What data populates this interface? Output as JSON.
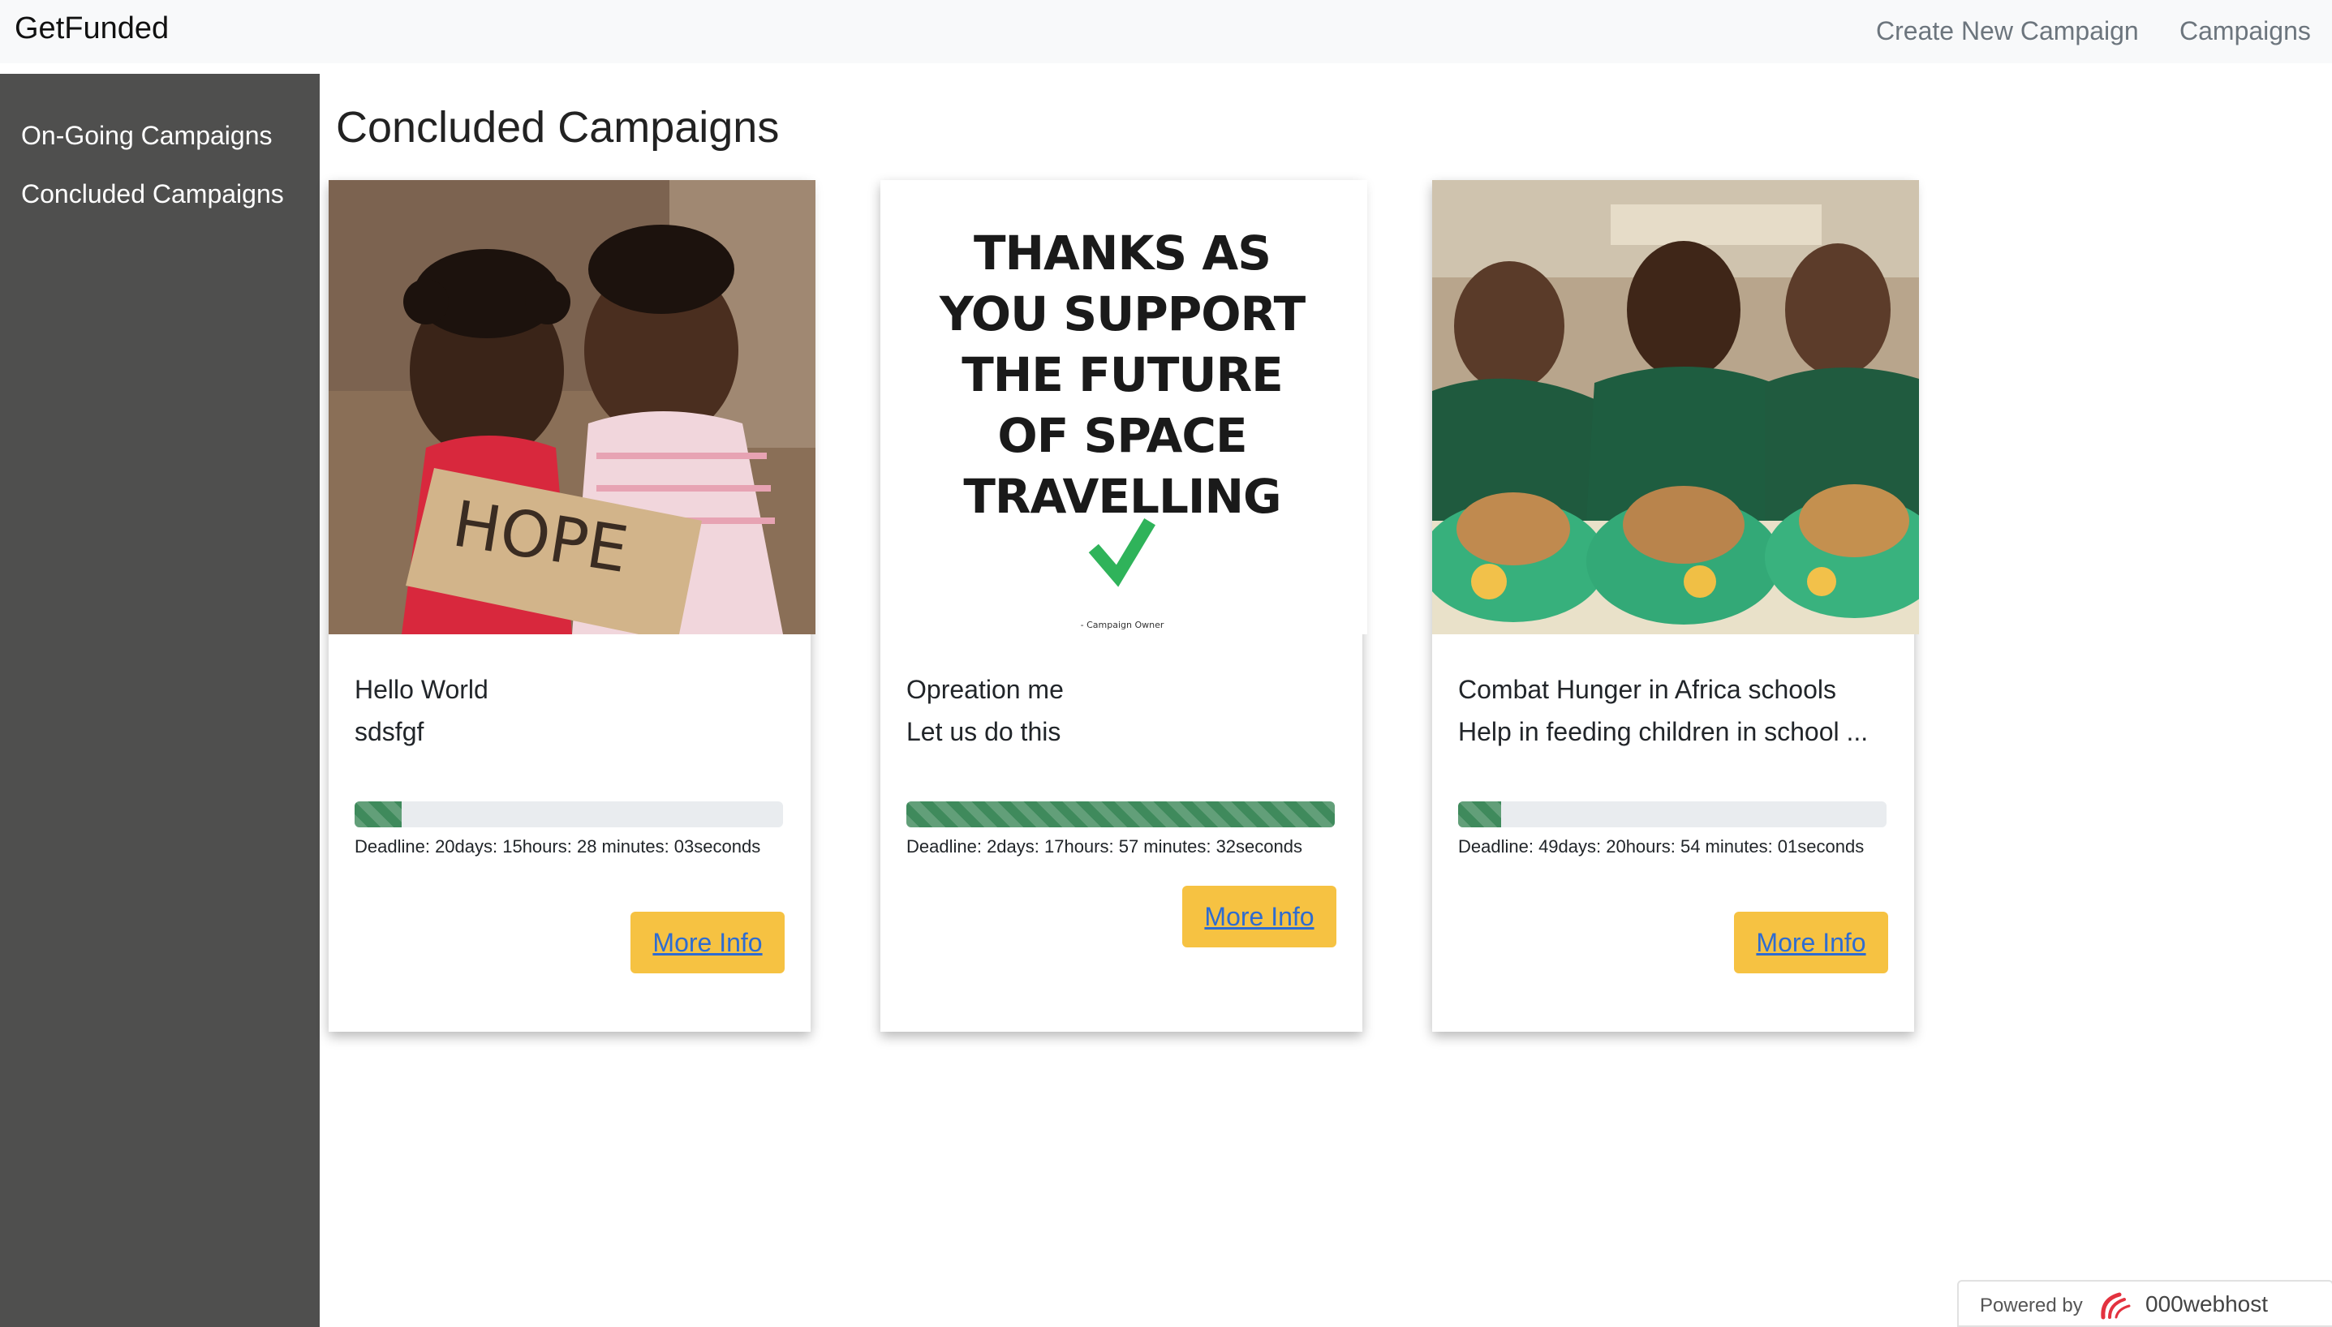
{
  "navbar": {
    "brand": "GetFunded",
    "links": [
      "Create New Campaign",
      "Campaigns"
    ]
  },
  "sidebar": {
    "items": [
      {
        "label": "On-Going Campaigns"
      },
      {
        "label": "Concluded Campaigns"
      }
    ]
  },
  "main": {
    "title": "Concluded Campaigns",
    "cards": [
      {
        "image_icon": "children-hope-sign-photo",
        "image_text": "HOPE",
        "title": "Hello World",
        "description": "sdsfgf",
        "progress": 0.11,
        "deadline": "Deadline: 20days: 15hours: 28 minutes: 03seconds",
        "button": "More Info"
      },
      {
        "image_icon": "thanks-poster-checkmark",
        "image_text_lines": [
          "THANKS AS",
          "YOU SUPPORT",
          "THE FUTURE",
          "OF SPACE",
          "TRAVELLING"
        ],
        "image_caption": "- Campaign Owner",
        "title": "Opreation me",
        "description": "Let us do this",
        "progress": 1.0,
        "deadline": "Deadline: 2days: 17hours: 57 minutes: 32seconds",
        "button": "More Info"
      },
      {
        "image_icon": "children-eating-photo",
        "title": "Combat Hunger in Africa schools",
        "description": "Help in feeding children in school ...",
        "progress": 0.1,
        "deadline": "Deadline: 49days: 20hours: 54 minutes: 01seconds",
        "button": "More Info"
      }
    ]
  },
  "footer": {
    "powered_label": "Powered by",
    "powered_brand": "000webhost"
  },
  "colors": {
    "navbar_bg": "#f8f9fa",
    "sidebar_bg": "#4f4f4e",
    "progress_fill": "#3f8a5c",
    "button_bg": "#f6c242",
    "button_text": "#2e6cd1"
  }
}
